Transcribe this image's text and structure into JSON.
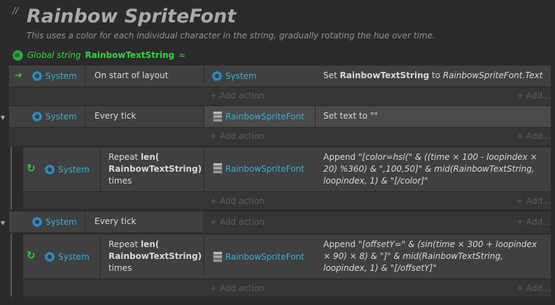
{
  "comment_marker": "//",
  "title": "Rainbow SpriteFont",
  "subtitle": "This uses a color for each individual character in the string, gradually rotating the hue over time.",
  "global_var": {
    "prefix": "Global string",
    "name": "RainbowTextString",
    "suffix": "="
  },
  "add_action": "+ Add action",
  "add_more": "+ Add...",
  "events": [
    {
      "object": "System",
      "condition": "On start of layout",
      "action_object": "System",
      "action_pre": "Set ",
      "action_bold": "RainbowTextString",
      "action_mid": " to ",
      "action_italic": "RainbowSpriteFont.Text"
    },
    {
      "object": "System",
      "condition": "Every tick",
      "action_object": "RainbowSpriteFont",
      "action_text": "Set text to \"\""
    },
    {
      "object": "System",
      "condition_pre": "Repeat ",
      "condition_bold": "len( RainbowTextString)",
      "condition_post": " times",
      "action_object": "RainbowSpriteFont",
      "action_pre": "Append ",
      "action_italic": "\"[color=hsl(\" & ((time × 100 - loopindex × 20) %360) & \",100,50]\" & mid(RainbowTextString, loopindex, 1) & \"[/color]\""
    },
    {
      "object": "System",
      "condition": "Every tick"
    },
    {
      "object": "System",
      "condition_pre": "Repeat ",
      "condition_bold": "len( RainbowTextString)",
      "condition_post": " times",
      "action_object": "RainbowSpriteFont",
      "action_pre": "Append ",
      "action_italic": "\"[offsetY=\" & (sin(time × 300 + loopindex × 90) × 8) & \"]\" & mid(RainbowTextString, loopindex, 1) & \"[/offsetY]\""
    }
  ]
}
